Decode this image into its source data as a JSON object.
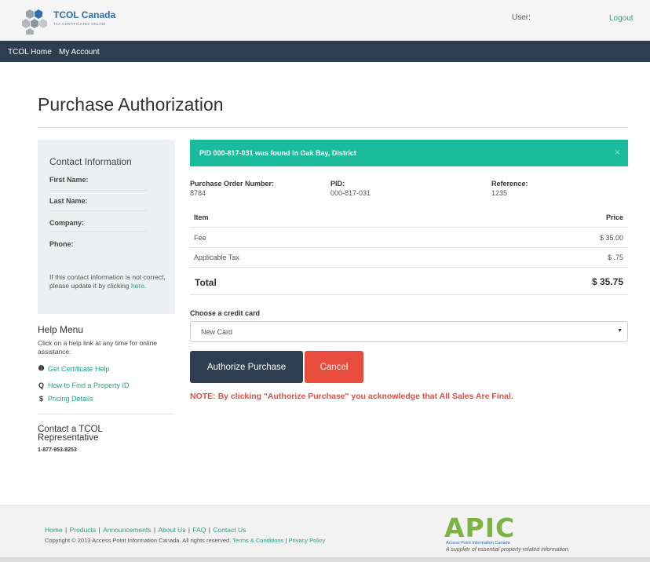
{
  "header": {
    "logo_text": "TCOL Canada",
    "logo_sub": "TAX CERTIFICATES ONLINE",
    "user_label": "User:",
    "logout_label": "Logout"
  },
  "nav": {
    "items": [
      {
        "label": "TCOL Home"
      },
      {
        "label": "My Account"
      }
    ]
  },
  "page": {
    "title": "Purchase Authorization"
  },
  "contact": {
    "heading": "Contact Information",
    "fields": [
      {
        "label": "First Name:"
      },
      {
        "label": "Last Name:"
      },
      {
        "label": "Company:"
      },
      {
        "label": "Phone:"
      }
    ],
    "note_prefix": "If this contact information is not correct, please update it by clicking ",
    "note_link": "here",
    "note_suffix": "."
  },
  "help": {
    "heading": "Help Menu",
    "description": "Click on a help link at any time for online assistance:",
    "links": [
      {
        "icon": "info-circle-icon",
        "glyph": "❶",
        "label": "Get Certificate Help"
      },
      {
        "icon": "search-icon",
        "glyph": "Q",
        "label": "How to Find a Property ID"
      },
      {
        "icon": "dollar-icon",
        "glyph": "$",
        "label": "Pricing Details"
      }
    ],
    "contact_rep": "Contact a TCOL Representative",
    "phone": "1-877-953-8253"
  },
  "alert": {
    "message": "PID 000-817-031 was found in Oak Bay, District",
    "close_glyph": "×",
    "color": "#1abc9c"
  },
  "order": {
    "po_label": "Purchase Order Number:",
    "po_value": "8784",
    "pid_label": "PID:",
    "pid_value": "000-817-031",
    "ref_label": "Reference:",
    "ref_value": "1235"
  },
  "table": {
    "headers": {
      "item": "Item",
      "price": "Price"
    },
    "rows": [
      {
        "item": "Fee",
        "price": "$ 35.00"
      },
      {
        "item": "Applicable Tax",
        "price": "$ .75"
      }
    ],
    "total_label": "Total",
    "total_value": "$ 35.75"
  },
  "payment": {
    "label": "Choose a credit card",
    "selected": "New Card",
    "caret": "▼"
  },
  "actions": {
    "authorize_label": "Authorize Purchase",
    "cancel_label": "Cancel",
    "note": "NOTE: By clicking \"Authorize Purchase\" you acknowledge that All Sales Are Final."
  },
  "footer": {
    "links": [
      "Home",
      "Products",
      "Announcements",
      "About Us",
      "FAQ",
      "Contact Us"
    ],
    "copyright": "Copyright © 2013 Access Point Information Canada. All rights reserved.",
    "terms": "Terms & Conditions",
    "privacy": "Privacy Policy",
    "brand": "APIC",
    "brand_name": "Access Point Information Canada",
    "brand_tagline": "A supplier of essential property related information."
  },
  "colors": {
    "navbar": "#2c3e50",
    "accent_link": "#2aa18a",
    "danger": "#e74c3c",
    "brand_green": "#7cb342"
  }
}
